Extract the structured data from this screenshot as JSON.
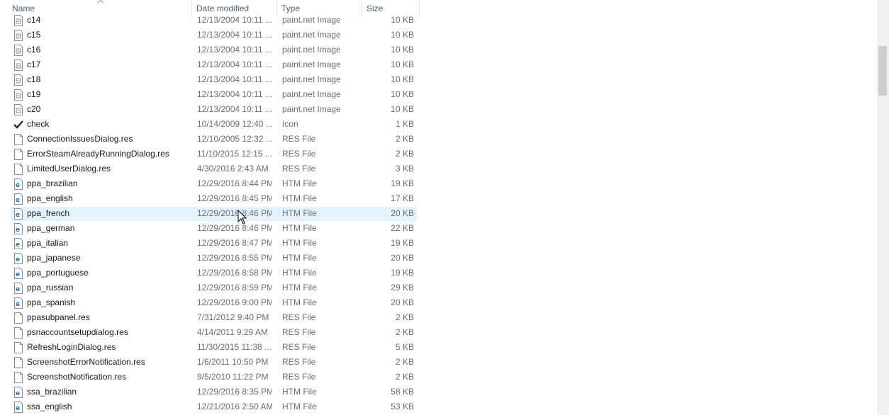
{
  "columns": {
    "name": "Name",
    "date": "Date modified",
    "type": "Type",
    "size": "Size"
  },
  "colors": {
    "header_text": "#4c607a",
    "selection": "#e5f3ff",
    "ie_icon": "#1f6fc5"
  },
  "files": [
    {
      "name": "c14",
      "date": "12/13/2004 10:11 ...",
      "type": "paint.net Image",
      "size": "10 KB",
      "icon": "paintnet-image-icon"
    },
    {
      "name": "c15",
      "date": "12/13/2004 10:11 ...",
      "type": "paint.net Image",
      "size": "10 KB",
      "icon": "paintnet-image-icon"
    },
    {
      "name": "c16",
      "date": "12/13/2004 10:11 ...",
      "type": "paint.net Image",
      "size": "10 KB",
      "icon": "paintnet-image-icon"
    },
    {
      "name": "c17",
      "date": "12/13/2004 10:11 ...",
      "type": "paint.net Image",
      "size": "10 KB",
      "icon": "paintnet-image-icon"
    },
    {
      "name": "c18",
      "date": "12/13/2004 10:11 ...",
      "type": "paint.net Image",
      "size": "10 KB",
      "icon": "paintnet-image-icon"
    },
    {
      "name": "c19",
      "date": "12/13/2004 10:11 ...",
      "type": "paint.net Image",
      "size": "10 KB",
      "icon": "paintnet-image-icon"
    },
    {
      "name": "c20",
      "date": "12/13/2004 10:11 ...",
      "type": "paint.net Image",
      "size": "10 KB",
      "icon": "paintnet-image-icon"
    },
    {
      "name": "check",
      "date": "10/14/2009 12:40 ...",
      "type": "Icon",
      "size": "1 KB",
      "icon": "checkmark-icon"
    },
    {
      "name": "ConnectionIssuesDialog.res",
      "date": "12/10/2005 12:32 ...",
      "type": "RES File",
      "size": "2 KB",
      "icon": "blank-file-icon"
    },
    {
      "name": "ErrorSteamAlreadyRunningDialog.res",
      "date": "11/10/2015 12:15 ...",
      "type": "RES File",
      "size": "2 KB",
      "icon": "blank-file-icon"
    },
    {
      "name": "LimitedUserDialog.res",
      "date": "4/30/2016 2:43 AM",
      "type": "RES File",
      "size": "3 KB",
      "icon": "blank-file-icon"
    },
    {
      "name": "ppa_brazilian",
      "date": "12/29/2016 8:44 PM",
      "type": "HTM File",
      "size": "19 KB",
      "icon": "htm-file-icon"
    },
    {
      "name": "ppa_english",
      "date": "12/29/2016 8:45 PM",
      "type": "HTM File",
      "size": "17 KB",
      "icon": "htm-file-icon"
    },
    {
      "name": "ppa_french",
      "date": "12/29/2016 8:46 PM",
      "type": "HTM File",
      "size": "20 KB",
      "icon": "htm-file-icon",
      "selected": true
    },
    {
      "name": "ppa_german",
      "date": "12/29/2016 8:46 PM",
      "type": "HTM File",
      "size": "22 KB",
      "icon": "htm-file-icon"
    },
    {
      "name": "ppa_italian",
      "date": "12/29/2016 8:47 PM",
      "type": "HTM File",
      "size": "19 KB",
      "icon": "htm-file-icon"
    },
    {
      "name": "ppa_japanese",
      "date": "12/29/2016 8:55 PM",
      "type": "HTM File",
      "size": "20 KB",
      "icon": "htm-file-icon"
    },
    {
      "name": "ppa_portuguese",
      "date": "12/29/2016 8:58 PM",
      "type": "HTM File",
      "size": "19 KB",
      "icon": "htm-file-icon"
    },
    {
      "name": "ppa_russian",
      "date": "12/29/2016 8:59 PM",
      "type": "HTM File",
      "size": "29 KB",
      "icon": "htm-file-icon"
    },
    {
      "name": "ppa_spanish",
      "date": "12/29/2016 9:00 PM",
      "type": "HTM File",
      "size": "20 KB",
      "icon": "htm-file-icon"
    },
    {
      "name": "ppasubpanel.res",
      "date": "7/31/2012 9:40 PM",
      "type": "RES File",
      "size": "2 KB",
      "icon": "blank-file-icon"
    },
    {
      "name": "psnaccountsetupdialog.res",
      "date": "4/14/2011 9:29 AM",
      "type": "RES File",
      "size": "2 KB",
      "icon": "blank-file-icon"
    },
    {
      "name": "RefreshLoginDialog.res",
      "date": "11/30/2015 11:38 ...",
      "type": "RES File",
      "size": "5 KB",
      "icon": "blank-file-icon"
    },
    {
      "name": "ScreenshotErrorNotification.res",
      "date": "1/6/2011 10:50 PM",
      "type": "RES File",
      "size": "2 KB",
      "icon": "blank-file-icon"
    },
    {
      "name": "ScreenshotNotification.res",
      "date": "9/5/2010 11:22 PM",
      "type": "RES File",
      "size": "2 KB",
      "icon": "blank-file-icon"
    },
    {
      "name": "ssa_brazilian",
      "date": "12/29/2016 8:35 PM",
      "type": "HTM File",
      "size": "58 KB",
      "icon": "htm-file-icon"
    },
    {
      "name": "ssa_english",
      "date": "12/21/2016 2:50 AM",
      "type": "HTM File",
      "size": "53 KB",
      "icon": "htm-file-icon"
    }
  ]
}
